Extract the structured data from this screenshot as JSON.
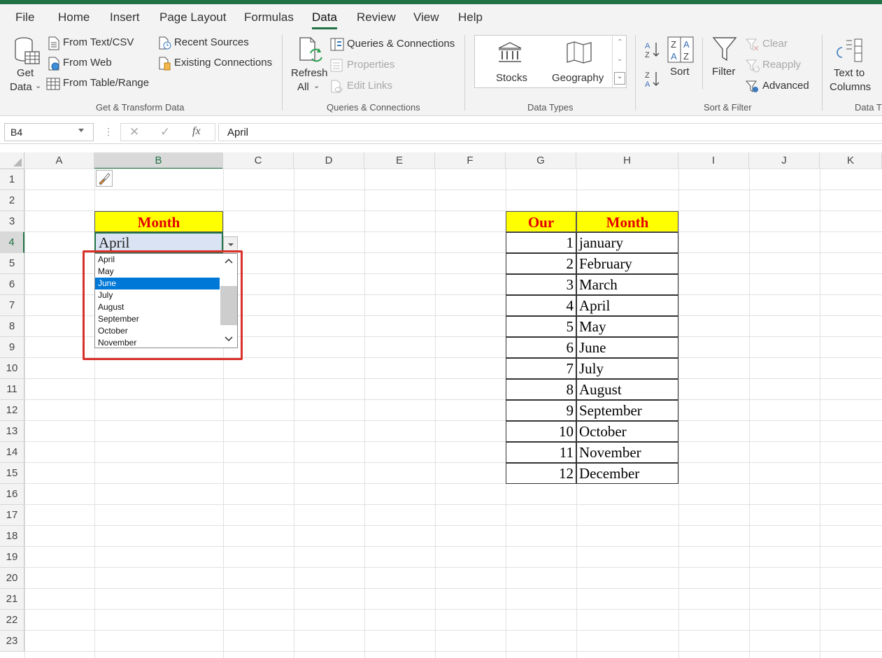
{
  "tabs": [
    "File",
    "Home",
    "Insert",
    "Page Layout",
    "Formulas",
    "Data",
    "Review",
    "View",
    "Help"
  ],
  "active_tab": "Data",
  "ribbon": {
    "get_transform": {
      "get_data_line1": "Get",
      "get_data_line2": "Data",
      "from_text_csv": "From Text/CSV",
      "from_web": "From Web",
      "from_table_range": "From Table/Range",
      "recent_sources": "Recent Sources",
      "existing_connections": "Existing Connections",
      "group_label": "Get & Transform Data"
    },
    "queries": {
      "refresh_line1": "Refresh",
      "refresh_line2": "All",
      "queries_connections": "Queries & Connections",
      "properties": "Properties",
      "edit_links": "Edit Links",
      "group_label": "Queries & Connections"
    },
    "data_types": {
      "stocks": "Stocks",
      "geography": "Geography",
      "group_label": "Data Types"
    },
    "sort_filter": {
      "sort": "Sort",
      "filter": "Filter",
      "clear": "Clear",
      "reapply": "Reapply",
      "advanced": "Advanced",
      "group_label": "Sort & Filter"
    },
    "data_tools": {
      "text_to_line1": "Text to",
      "text_to_line2": "Columns",
      "group_label": "Data T"
    }
  },
  "formula_bar": {
    "name_box": "B4",
    "fx": "fx",
    "value": "April"
  },
  "columns": [
    "A",
    "B",
    "C",
    "D",
    "E",
    "F",
    "G",
    "H",
    "I",
    "J",
    "K"
  ],
  "selected_column": "B",
  "rows": [
    "1",
    "2",
    "3",
    "4",
    "5",
    "6",
    "7",
    "8",
    "9",
    "10",
    "11",
    "12",
    "13",
    "14",
    "15",
    "16",
    "17",
    "18",
    "19",
    "20",
    "21",
    "22",
    "23"
  ],
  "selected_row": "4",
  "cells": {
    "b3": "Month",
    "b4": "April"
  },
  "dropdown": {
    "options": [
      "April",
      "May",
      "June",
      "July",
      "August",
      "September",
      "October",
      "November"
    ],
    "highlighted": "June"
  },
  "table": {
    "header_number": "Our",
    "header_month": "Month",
    "rows": [
      {
        "n": "1",
        "month": "january"
      },
      {
        "n": "2",
        "month": "February"
      },
      {
        "n": "3",
        "month": "March"
      },
      {
        "n": "4",
        "month": "April"
      },
      {
        "n": "5",
        "month": "May"
      },
      {
        "n": "6",
        "month": "June"
      },
      {
        "n": "7",
        "month": "July"
      },
      {
        "n": "8",
        "month": "August"
      },
      {
        "n": "9",
        "month": "September"
      },
      {
        "n": "10",
        "month": "October"
      },
      {
        "n": "11",
        "month": "November"
      },
      {
        "n": "12",
        "month": "December"
      }
    ]
  },
  "colors": {
    "accent": "#217346",
    "header_fill": "#ffff00",
    "header_text": "#e30000",
    "selection_blue": "#0078d7",
    "callout_red": "#d9302a"
  },
  "icons": [
    "database-icon",
    "text-file-icon",
    "web-icon",
    "table-icon",
    "recent-sources-icon",
    "existing-connections-icon",
    "refresh-icon",
    "queries-icon",
    "properties-icon",
    "edit-links-icon",
    "stocks-icon",
    "geography-icon",
    "sort-az-icon",
    "sort-za-icon",
    "sort-icon",
    "filter-icon",
    "clear-filter-icon",
    "reapply-icon",
    "advanced-filter-icon",
    "text-to-columns-icon",
    "paint-brush-icon"
  ]
}
